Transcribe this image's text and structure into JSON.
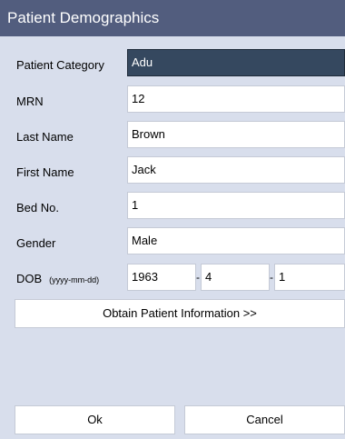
{
  "window": {
    "title": "Patient Demographics"
  },
  "fields": {
    "patient_category": {
      "label": "Patient Category",
      "value": "Adu"
    },
    "mrn": {
      "label": "MRN",
      "value": "12"
    },
    "last_name": {
      "label": "Last Name",
      "value": "Brown"
    },
    "first_name": {
      "label": "First Name",
      "value": "Jack"
    },
    "bed_no": {
      "label": "Bed No.",
      "value": "1"
    },
    "gender": {
      "label": "Gender",
      "value": "Male"
    },
    "dob": {
      "label": "DOB",
      "format_hint": "(yyyy-mm-dd)",
      "year": "1963",
      "month": "4",
      "day": "1",
      "sep1": "-",
      "sep2": "-"
    }
  },
  "actions": {
    "obtain_info_label": "Obtain Patient Information >>",
    "ok_label": "Ok",
    "cancel_label": "Cancel"
  },
  "colors": {
    "titlebar": "#525d7e",
    "body": "#d8deec",
    "active_field": "#35485f"
  }
}
